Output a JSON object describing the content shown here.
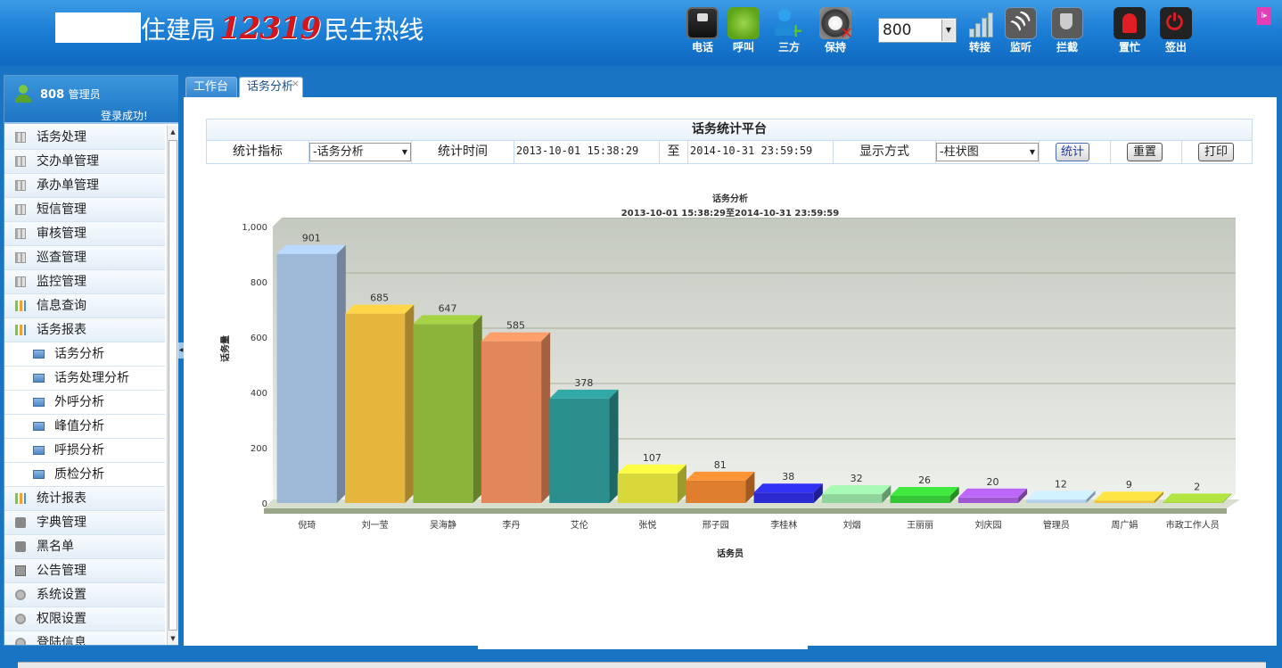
{
  "header": {
    "title_left": "住建局",
    "title_hot": "12319",
    "title_right": "民生热线",
    "tools": [
      {
        "id": "phone",
        "label": "电话",
        "icon": "phone-icon"
      },
      {
        "id": "call",
        "label": "呼叫",
        "icon": "call-icon"
      },
      {
        "id": "three",
        "label": "三方",
        "icon": "add-user-icon"
      },
      {
        "id": "hold",
        "label": "保持",
        "icon": "hold-icon"
      },
      {
        "id": "transfer",
        "label": "转接",
        "icon": "transfer-icon"
      },
      {
        "id": "listen",
        "label": "监听",
        "icon": "listen-icon"
      },
      {
        "id": "intercept",
        "label": "拦截",
        "icon": "intercept-icon"
      },
      {
        "id": "busy",
        "label": "置忙",
        "icon": "busy-icon"
      },
      {
        "id": "logout",
        "label": "签出",
        "icon": "logout-icon"
      }
    ],
    "extension": "800"
  },
  "user": {
    "name": "808",
    "role": "管理员",
    "status": "登录成功!"
  },
  "menu": [
    {
      "label": "话务处理",
      "icon": "grid",
      "sub": false
    },
    {
      "label": "交办单管理",
      "icon": "grid",
      "sub": false
    },
    {
      "label": "承办单管理",
      "icon": "grid",
      "sub": false
    },
    {
      "label": "短信管理",
      "icon": "grid",
      "sub": false
    },
    {
      "label": "审核管理",
      "icon": "grid",
      "sub": false
    },
    {
      "label": "巡查管理",
      "icon": "grid",
      "sub": false
    },
    {
      "label": "监控管理",
      "icon": "grid",
      "sub": false
    },
    {
      "label": "信息查询",
      "icon": "bars",
      "sub": false
    },
    {
      "label": "话务报表",
      "icon": "bars",
      "sub": false
    },
    {
      "label": "话务分析",
      "icon": "sub",
      "sub": true
    },
    {
      "label": "话务处理分析",
      "icon": "sub",
      "sub": true
    },
    {
      "label": "外呼分析",
      "icon": "sub",
      "sub": true
    },
    {
      "label": "峰值分析",
      "icon": "sub",
      "sub": true
    },
    {
      "label": "呼损分析",
      "icon": "sub",
      "sub": true
    },
    {
      "label": "质检分析",
      "icon": "sub",
      "sub": true
    },
    {
      "label": "统计报表",
      "icon": "bars",
      "sub": false
    },
    {
      "label": "字典管理",
      "icon": "msg",
      "sub": false
    },
    {
      "label": "黑名单",
      "icon": "msg",
      "sub": false
    },
    {
      "label": "公告管理",
      "icon": "doc",
      "sub": false
    },
    {
      "label": "系统设置",
      "icon": "gear",
      "sub": false
    },
    {
      "label": "权限设置",
      "icon": "gear",
      "sub": false
    },
    {
      "label": "登陆信息",
      "icon": "gear",
      "sub": false
    }
  ],
  "tabs": {
    "work": "工作台",
    "analysis": "话务分析",
    "close": "×"
  },
  "panel": {
    "title": "话务统计平台",
    "metric_label": "统计指标",
    "metric_value": "-话务分析",
    "time_label": "统计时间",
    "time_start": "2013-10-01 15:38:29",
    "to": "至",
    "time_end": "2014-10-31 23:59:59",
    "display_label": "显示方式",
    "display_value": "-柱状图",
    "btn_stat": "统计",
    "btn_reset": "重置",
    "btn_print": "打印"
  },
  "chart_data": {
    "type": "bar",
    "title": "话务分析",
    "subtitle": "2013-10-01 15:38:29至2014-10-31 23:59:59",
    "xlabel": "话务员",
    "ylabel": "话务量",
    "ylim": [
      0,
      1000
    ],
    "yticks": [
      "0",
      "200",
      "400",
      "600",
      "800",
      "1,000"
    ],
    "grid": true,
    "categories": [
      "倪琦",
      "刘一莹",
      "吴海静",
      "李丹",
      "艾伦",
      "张悦",
      "邢子园",
      "李桂林",
      "刘烟",
      "王丽丽",
      "刘庆园",
      "管理员",
      "周广娟",
      "市政工作人员"
    ],
    "values": [
      901,
      685,
      647,
      585,
      378,
      107,
      81,
      38,
      32,
      26,
      20,
      12,
      9,
      2
    ],
    "colors": [
      "#9eb9d8",
      "#e5b53c",
      "#8cb33a",
      "#e2875a",
      "#2a8f8d",
      "#d8d83a",
      "#df7e2e",
      "#2a2ad0",
      "#8fd49a",
      "#36c536",
      "#a057d2",
      "#b3cdea",
      "#f0c23a",
      "#98c238"
    ]
  }
}
